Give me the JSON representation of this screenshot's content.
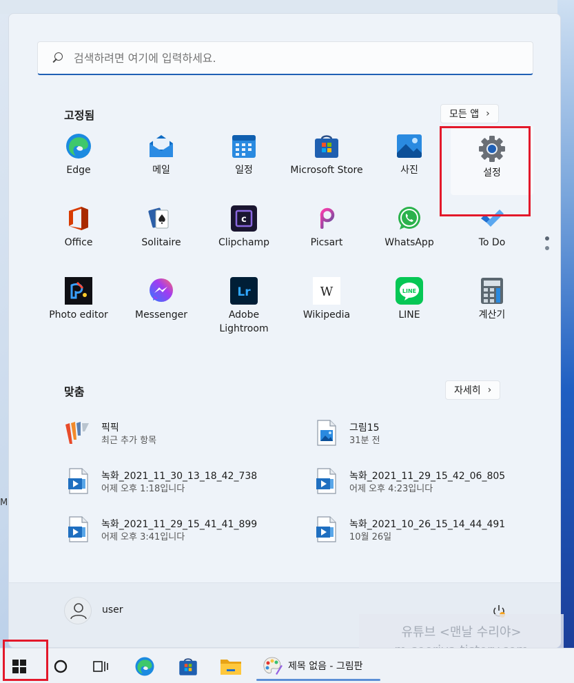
{
  "search": {
    "placeholder": "검색하려면 여기에 입력하세요."
  },
  "pinned": {
    "title": "고정됨",
    "all_apps_label": "모든 앱",
    "apps": [
      {
        "label": "Edge",
        "icon": "edge-icon"
      },
      {
        "label": "메일",
        "icon": "mail-icon"
      },
      {
        "label": "일정",
        "icon": "calendar-icon"
      },
      {
        "label": "Microsoft Store",
        "icon": "store-icon"
      },
      {
        "label": "사진",
        "icon": "photos-icon"
      },
      {
        "label": "설정",
        "icon": "gear-icon"
      },
      {
        "label": "Office",
        "icon": "office-icon"
      },
      {
        "label": "Solitaire",
        "icon": "solitaire-icon"
      },
      {
        "label": "Clipchamp",
        "icon": "clipchamp-icon"
      },
      {
        "label": "Picsart",
        "icon": "picsart-icon"
      },
      {
        "label": "WhatsApp",
        "icon": "whatsapp-icon"
      },
      {
        "label": "To Do",
        "icon": "todo-icon"
      },
      {
        "label": "Photo editor",
        "icon": "photo-editor-icon"
      },
      {
        "label": "Messenger",
        "icon": "messenger-icon"
      },
      {
        "label": "Adobe Lightroom",
        "icon": "lightroom-icon"
      },
      {
        "label": "Wikipedia",
        "icon": "wikipedia-icon"
      },
      {
        "label": "LINE",
        "icon": "line-icon"
      },
      {
        "label": "계산기",
        "icon": "calculator-icon"
      }
    ]
  },
  "recommended": {
    "title": "맞춤",
    "more_label": "자세히",
    "items": [
      {
        "name": "픽픽",
        "sub": "최근 추가 항목",
        "icon": "picpick-icon"
      },
      {
        "name": "그림15",
        "sub": "31분 전",
        "icon": "image-file-icon"
      },
      {
        "name": "녹화_2021_11_30_13_18_42_738",
        "sub": "어제 오후 1:18입니다",
        "icon": "video-file-icon"
      },
      {
        "name": "녹화_2021_11_29_15_42_06_805",
        "sub": "어제 오후 4:23입니다",
        "icon": "video-file-icon"
      },
      {
        "name": "녹화_2021_11_29_15_41_41_899",
        "sub": "어제 오후 3:41입니다",
        "icon": "video-file-icon"
      },
      {
        "name": "녹화_2021_10_26_15_14_44_491",
        "sub": "10월 26일",
        "icon": "video-file-icon"
      }
    ]
  },
  "user": {
    "name": "user"
  },
  "watermark": {
    "line1": "유튜브 <맨날 수리야>",
    "line2": "m-sooriya.tistory.com"
  },
  "taskbar": {
    "paint_label": "제목 없음 - 그림판"
  },
  "edge_letter": "M",
  "colors": {
    "accent": "#1f5fb5",
    "highlight": "#e3182a"
  }
}
